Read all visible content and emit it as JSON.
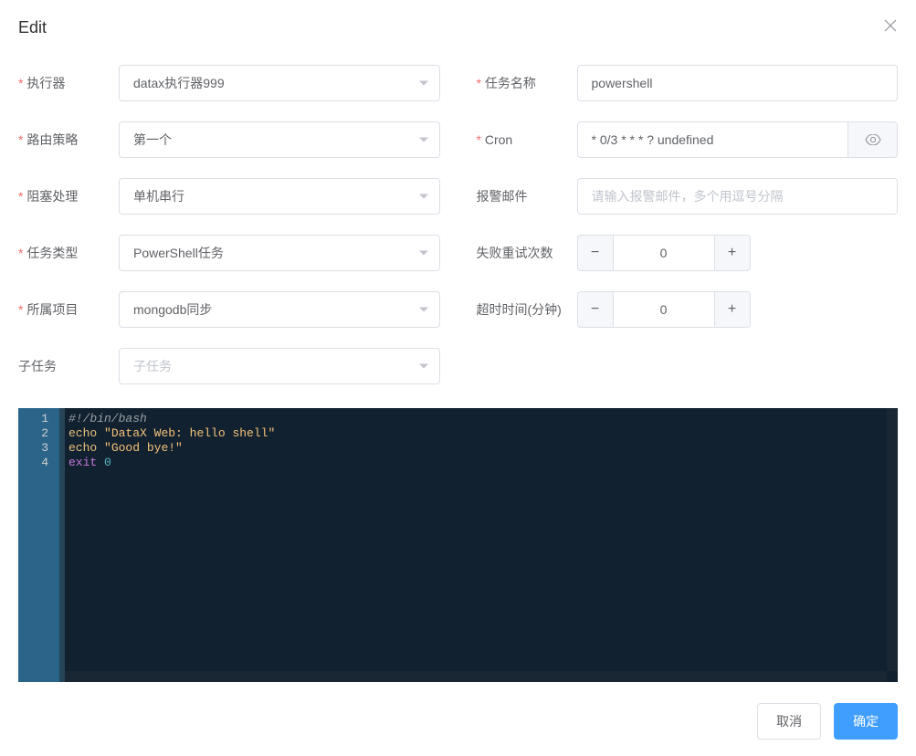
{
  "dialog": {
    "title": "Edit"
  },
  "form": {
    "left": {
      "executor": {
        "label": "执行器",
        "value": "datax执行器999"
      },
      "route": {
        "label": "路由策略",
        "value": "第一个"
      },
      "block": {
        "label": "阻塞处理",
        "value": "单机串行"
      },
      "taskType": {
        "label": "任务类型",
        "value": "PowerShell任务"
      },
      "project": {
        "label": "所属项目",
        "value": "mongodb同步"
      },
      "subTask": {
        "label": "子任务",
        "placeholder": "子任务"
      }
    },
    "right": {
      "taskName": {
        "label": "任务名称",
        "value": "powershell"
      },
      "cron": {
        "label": "Cron",
        "value": "* 0/3 * * * ? undefined"
      },
      "alertEmail": {
        "label": "报警邮件",
        "placeholder": "请输入报警邮件，多个用逗号分隔"
      },
      "retry": {
        "label": "失败重试次数",
        "value": "0"
      },
      "timeout": {
        "label": "超时时间(分钟)",
        "value": "0"
      }
    }
  },
  "editor": {
    "lines": {
      "l1_comment": "#!/bin/bash",
      "l2_cmd": "echo",
      "l2_str": "\"DataX Web: hello shell\"",
      "l3_cmd": "echo",
      "l3_str": "\"Good bye!\"",
      "l4_kw": "exit",
      "l4_num": "0"
    },
    "lineNumbers": [
      "1",
      "2",
      "3",
      "4"
    ]
  },
  "footer": {
    "cancel": "取消",
    "confirm": "确定"
  },
  "icons": {
    "minus": "−",
    "plus": "+"
  }
}
